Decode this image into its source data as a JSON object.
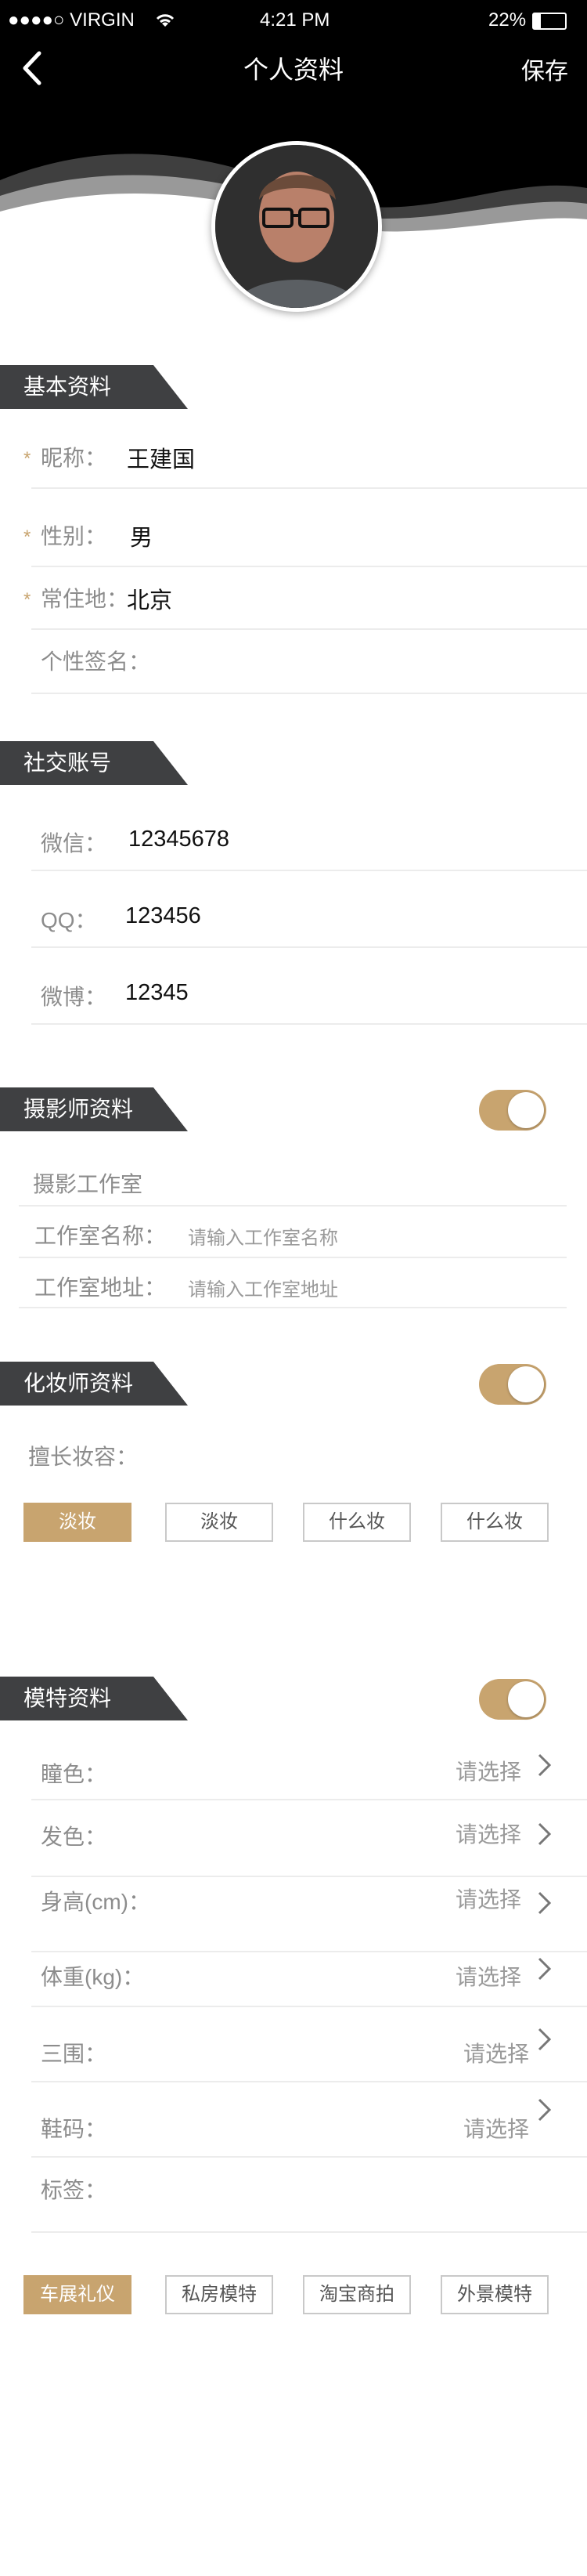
{
  "status_bar": {
    "carrier": "●●●●○ VIRGIN",
    "time": "4:21 PM",
    "battery": "22%"
  },
  "nav": {
    "title": "个人资料",
    "save_label": "保存"
  },
  "accent_color": "#c8a46f",
  "sections": {
    "basic": {
      "title": "基本资料",
      "fields": [
        {
          "label": "昵称：",
          "value": "王建国",
          "required": true
        },
        {
          "label": "性别：",
          "value": "男",
          "required": true
        },
        {
          "label": "常住地：",
          "value": "北京",
          "required": true
        },
        {
          "label": "个性签名：",
          "value": "",
          "required": false
        }
      ]
    },
    "social": {
      "title": "社交账号",
      "fields": [
        {
          "label": "微信：",
          "value": "12345678"
        },
        {
          "label": "QQ：",
          "value": "123456"
        },
        {
          "label": "微博：",
          "value": "12345"
        }
      ]
    },
    "photographer": {
      "title": "摄影师资料",
      "toggle_on": true,
      "studio_heading": "摄影工作室",
      "fields": [
        {
          "label": "工作室名称：",
          "placeholder": "请输入工作室名称"
        },
        {
          "label": "工作室地址：",
          "placeholder": "请输入工作室地址"
        }
      ]
    },
    "makeup": {
      "title": "化妆师资料",
      "toggle_on": true,
      "skills_label": "擅长妆容：",
      "chips": [
        {
          "label": "淡妆",
          "selected": true
        },
        {
          "label": "淡妆",
          "selected": false
        },
        {
          "label": "什么妆",
          "selected": false
        },
        {
          "label": "什么妆",
          "selected": false
        }
      ]
    },
    "model": {
      "title": "模特资料",
      "toggle_on": true,
      "select_placeholder": "请选择",
      "fields": [
        {
          "label": "瞳色："
        },
        {
          "label": "发色："
        },
        {
          "label": "身高(cm)："
        },
        {
          "label": "体重(kg)："
        },
        {
          "label": "三围："
        },
        {
          "label": "鞋码："
        }
      ],
      "tags_label": "标签：",
      "chips": [
        {
          "label": "车展礼仪",
          "selected": true
        },
        {
          "label": "私房模特",
          "selected": false
        },
        {
          "label": "淘宝商拍",
          "selected": false
        },
        {
          "label": "外景模特",
          "selected": false
        }
      ]
    }
  }
}
